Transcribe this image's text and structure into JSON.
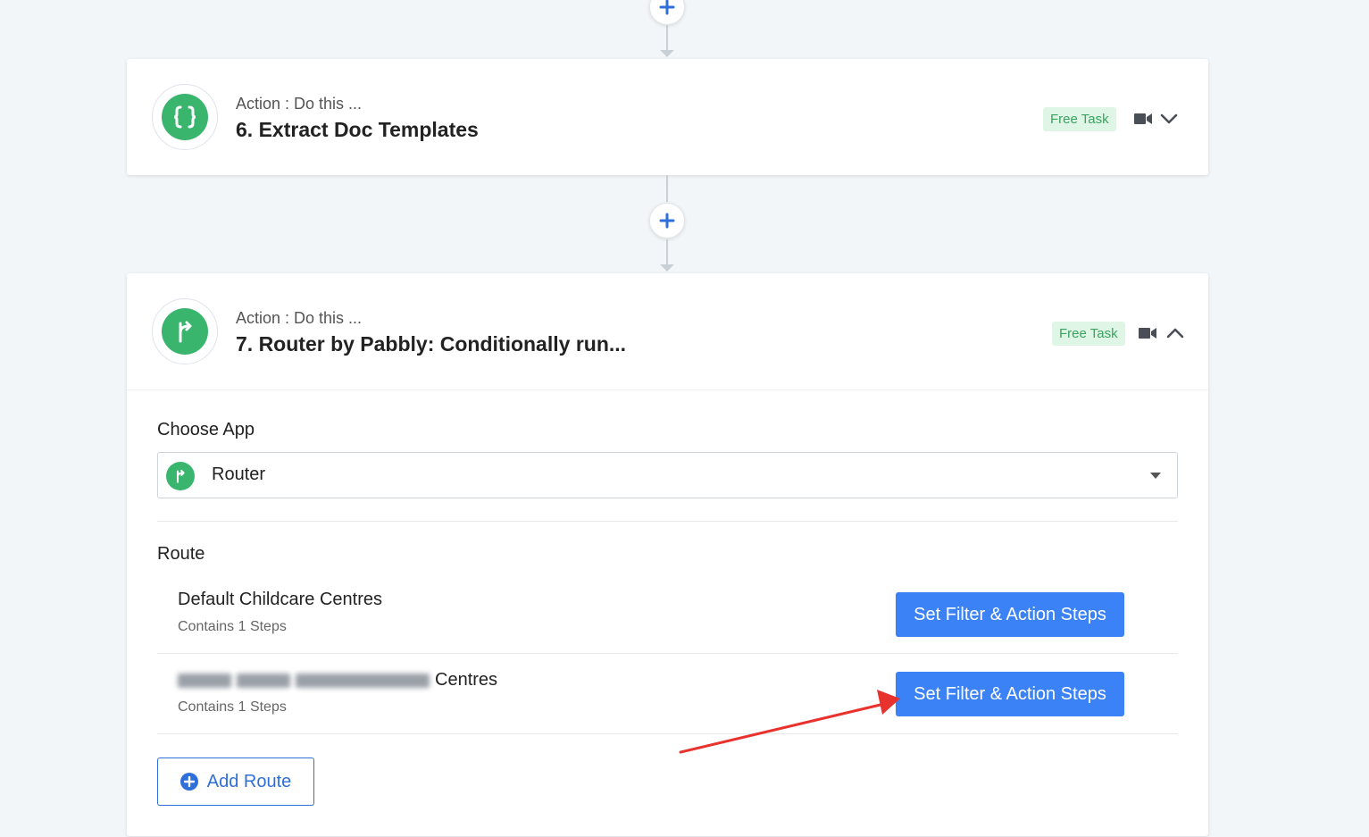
{
  "step6": {
    "action_label": "Action : Do this ...",
    "title": "6. Extract Doc Templates",
    "badge": "Free Task",
    "icon": "curly-braces-icon",
    "collapse_icon": "chevron-down-icon"
  },
  "step7": {
    "action_label": "Action : Do this ...",
    "title": "7. Router by Pabbly: Conditionally run...",
    "badge": "Free Task",
    "icon": "router-branch-icon",
    "collapse_icon": "chevron-up-icon",
    "choose_app_label": "Choose App",
    "selected_app": "Router",
    "route_label": "Route",
    "routes": [
      {
        "name": "Default Childcare Centres",
        "steps": "Contains 1 Steps",
        "button": "Set Filter & Action Steps"
      },
      {
        "name": "Centres",
        "steps": "Contains 1 Steps",
        "button": "Set Filter & Action Steps"
      }
    ],
    "add_route": "Add Route"
  },
  "colors": {
    "accent": "#3b82f6",
    "brand_green": "#3ab56e",
    "badge_bg": "#dff5e6",
    "annotation": "#e8322e"
  }
}
